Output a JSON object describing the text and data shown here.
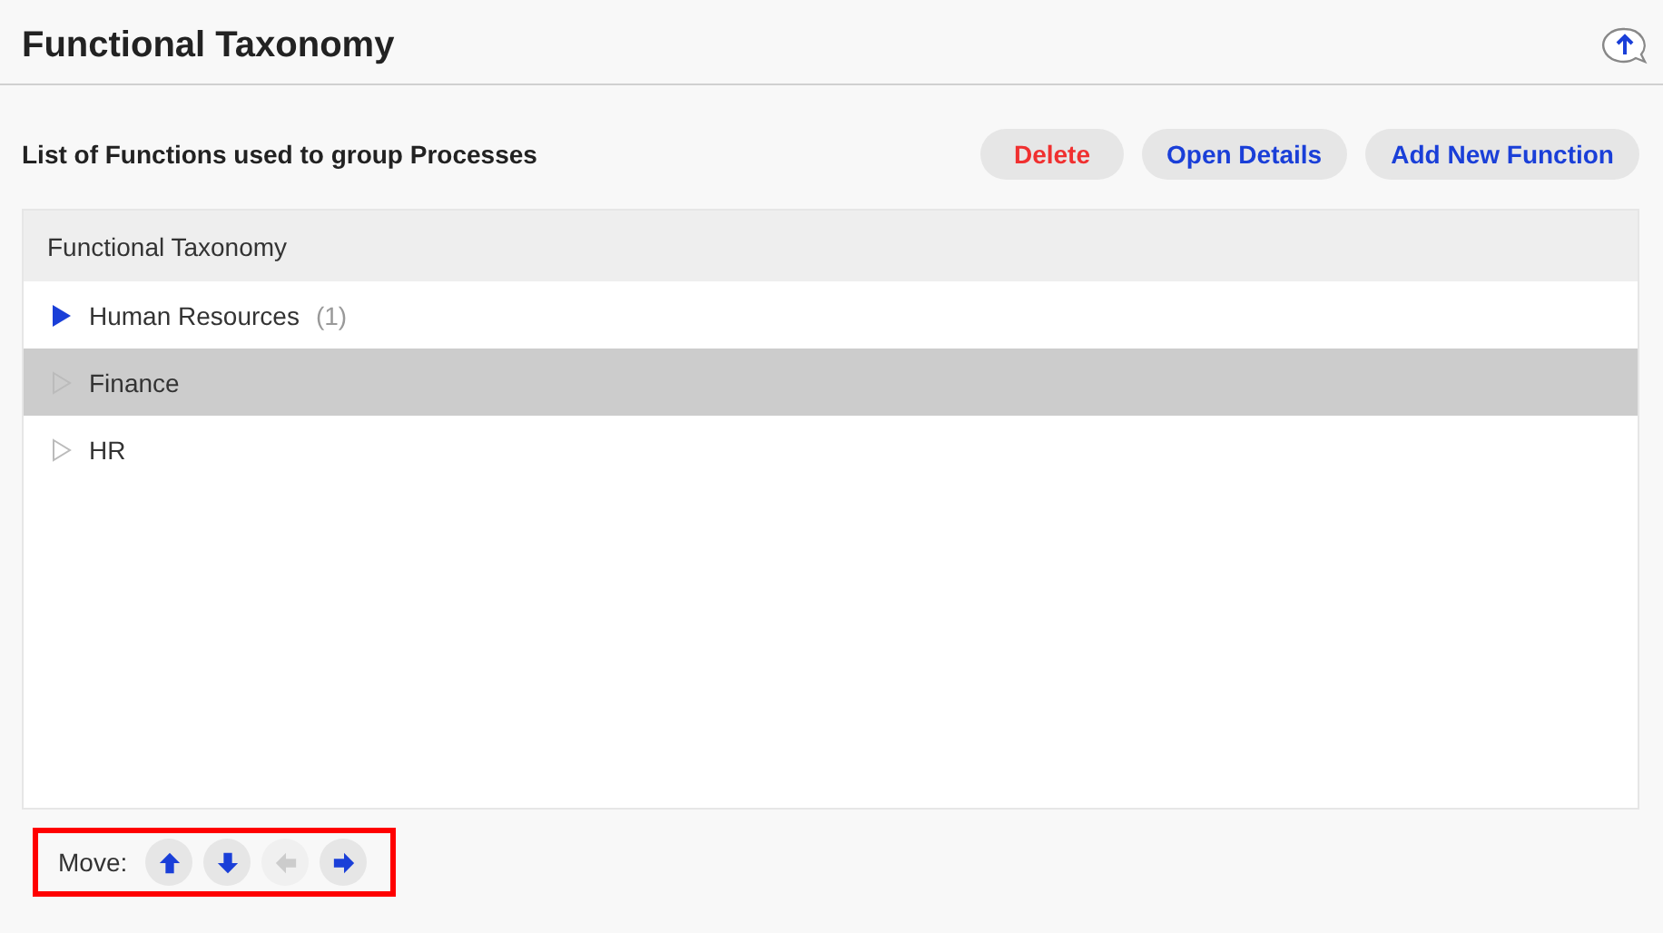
{
  "header": {
    "title": "Functional Taxonomy"
  },
  "toolbar": {
    "description": "List of Functions used to group Processes",
    "buttons": [
      {
        "label": "Delete",
        "kind": "danger"
      },
      {
        "label": "Open Details",
        "kind": "normal"
      },
      {
        "label": "Add New Function",
        "kind": "normal"
      }
    ]
  },
  "tree": {
    "heading": "Functional Taxonomy",
    "items": [
      {
        "label": "Human Resources",
        "count": "(1)",
        "expandable": true,
        "selected": false
      },
      {
        "label": "Finance",
        "expandable": false,
        "selected": true
      },
      {
        "label": "HR",
        "expandable": false,
        "selected": false
      }
    ]
  },
  "move_bar": {
    "label": "Move:",
    "highlighted": true,
    "buttons": [
      {
        "kind": "up",
        "disabled": false
      },
      {
        "kind": "down",
        "disabled": false
      },
      {
        "kind": "left",
        "disabled": true
      },
      {
        "kind": "right",
        "disabled": false
      }
    ]
  }
}
